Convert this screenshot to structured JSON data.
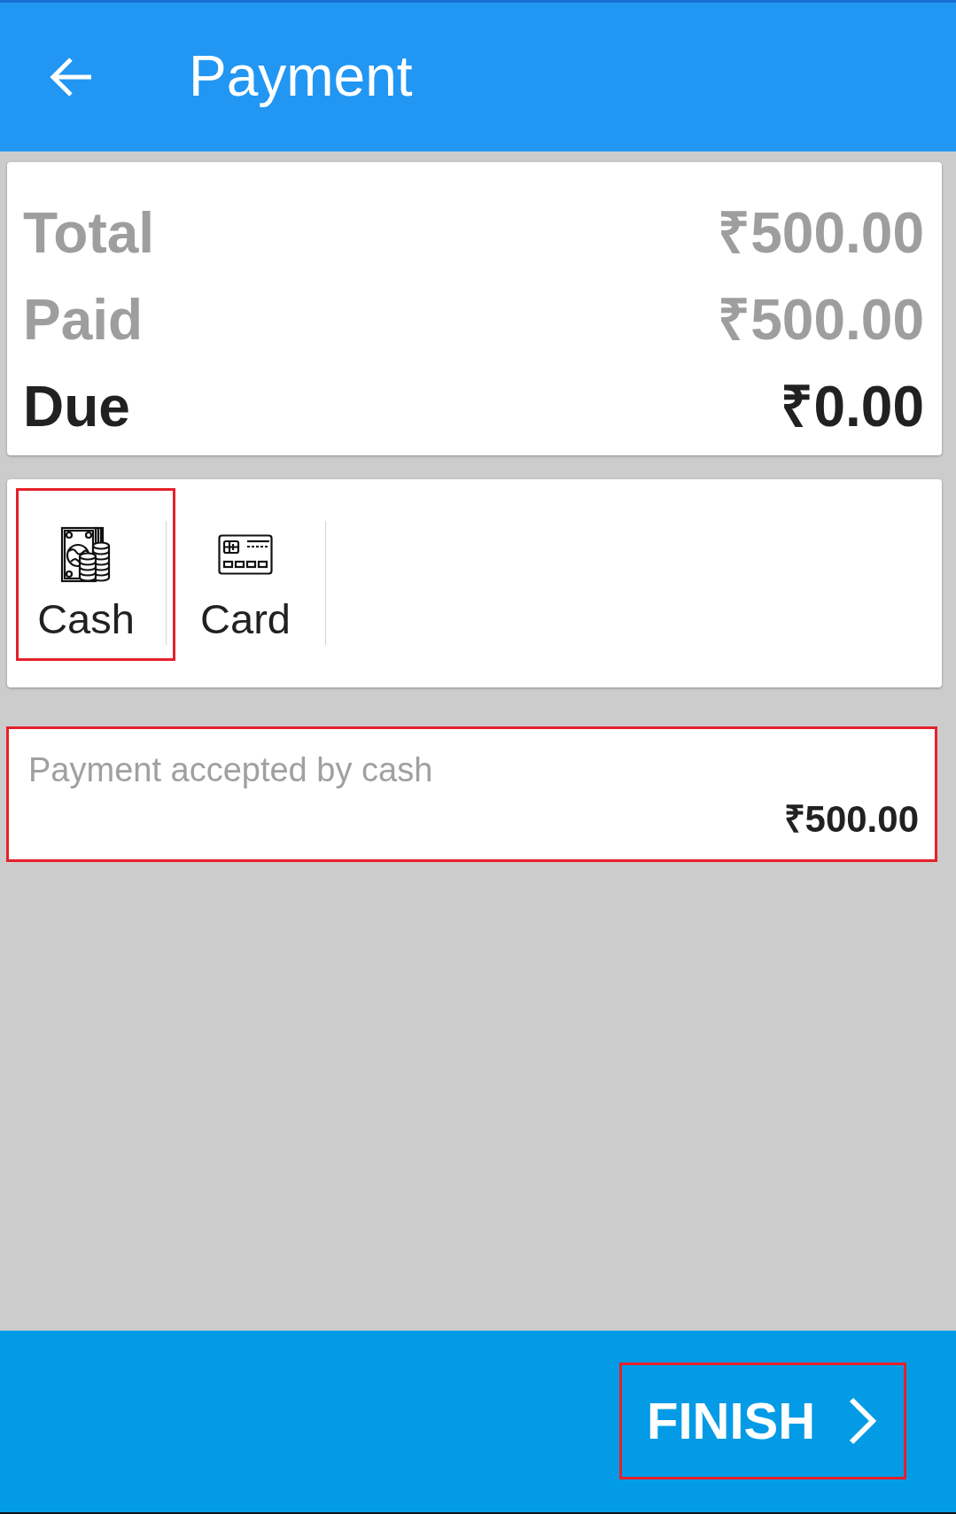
{
  "header": {
    "title": "Payment"
  },
  "summary": [
    {
      "label": "Total",
      "amount": "₹500.00",
      "emphasized": false
    },
    {
      "label": "Paid",
      "amount": "₹500.00",
      "emphasized": false
    },
    {
      "label": "Due",
      "amount": "₹0.00",
      "emphasized": true
    }
  ],
  "methods": [
    {
      "kind": "cash",
      "label": "Cash",
      "highlighted": true
    },
    {
      "kind": "card",
      "label": "Card",
      "highlighted": false
    }
  ],
  "payment_field": {
    "label": "Payment accepted by cash",
    "value": "₹500.00",
    "highlighted": true
  },
  "footer": {
    "button": {
      "label": "FINISH",
      "highlighted": true
    }
  }
}
